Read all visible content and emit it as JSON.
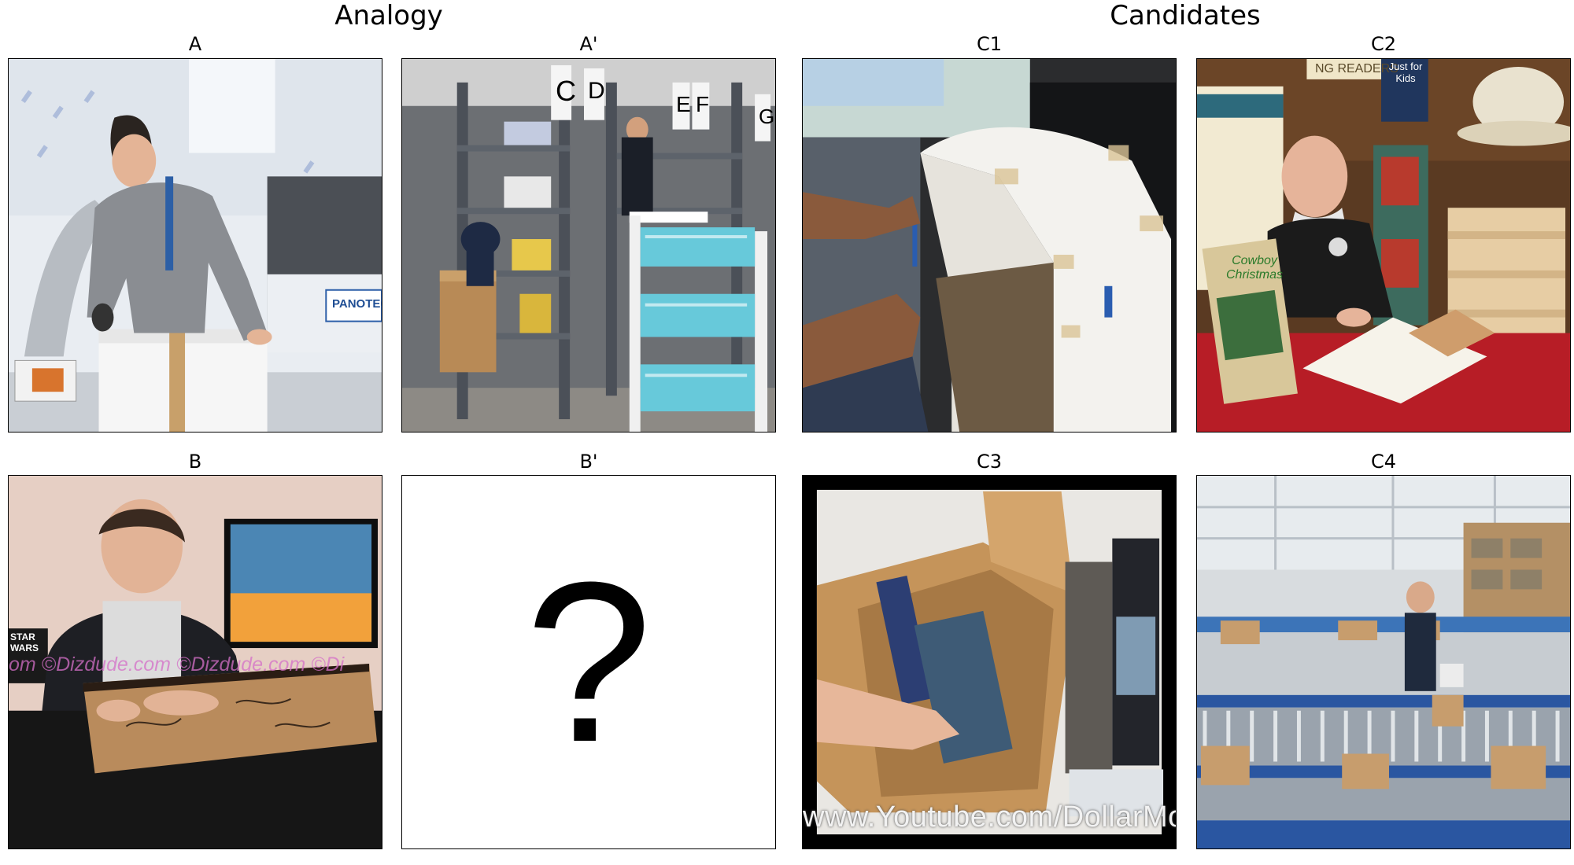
{
  "headings": {
    "analogy": "Analogy",
    "candidates": "Candidates"
  },
  "panels": {
    "a": {
      "label": "A",
      "sign": "PANOTEC"
    },
    "a_prime": {
      "label": "A'",
      "shelf_letters": [
        "C",
        "D",
        "E",
        "F",
        "G"
      ]
    },
    "b": {
      "label": "B",
      "watermark": "om ©Dizdude.com ©Dizdude.com ©Di",
      "sign": "STAR WARS"
    },
    "b_prime": {
      "label": "B'",
      "placeholder": "?"
    },
    "c1": {
      "label": "C1"
    },
    "c2": {
      "label": "C2",
      "sign": "NG READERS",
      "banner": "Just for Kids",
      "book_title": "Cowboy Christmas"
    },
    "c3": {
      "label": "C3",
      "watermark": "www.Youtube.com/DollarMoves"
    },
    "c4": {
      "label": "C4"
    }
  }
}
